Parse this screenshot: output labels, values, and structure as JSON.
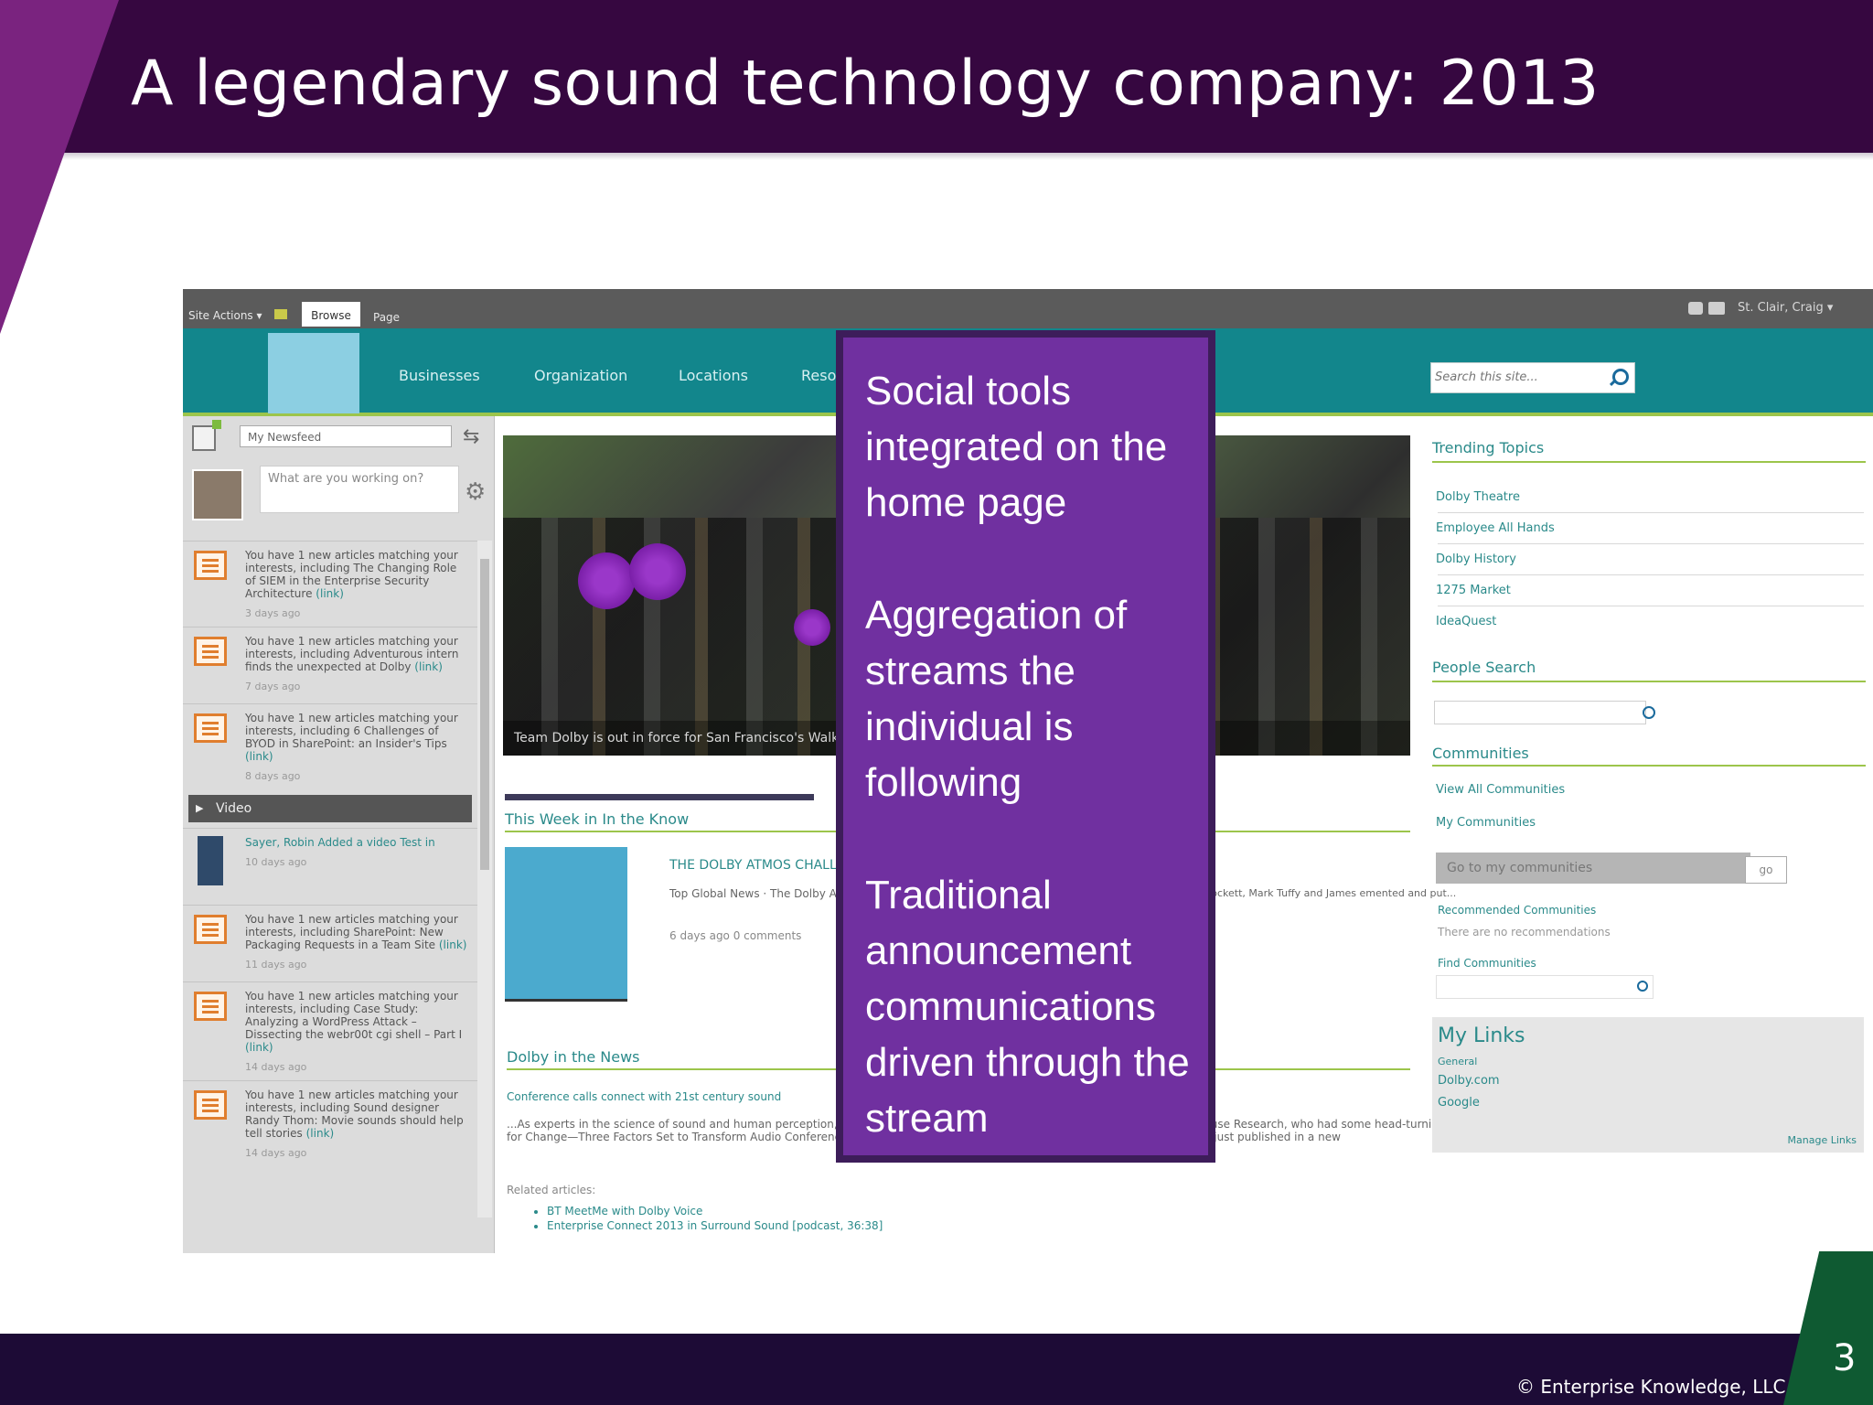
{
  "slide": {
    "title": "A legendary sound technology company: 2013",
    "page_number": "3",
    "copyright": "© Enterprise Knowledge, LLC"
  },
  "colors": {
    "title_bar": "#360740",
    "accent_purple": "#7a237f",
    "footer_bar": "#1d0b36",
    "callout": "#7030a0",
    "nav_teal": "#12868c",
    "link_teal": "#2a8a8a"
  },
  "ribbon": {
    "site_actions": "Site Actions ▾",
    "tab_browse": "Browse",
    "tab_page": "Page",
    "user": "St. Clair, Craig ▾"
  },
  "nav": {
    "items": [
      "Businesses",
      "Organization",
      "Locations",
      "Reso"
    ],
    "search_placeholder": "Search this site..."
  },
  "newsfeed": {
    "selector": "My Newsfeed",
    "status_placeholder": "What are you working on?",
    "items": [
      {
        "text": "You have 1 new articles matching your interests, including The Changing Role of SIEM in the Enterprise Security Architecture",
        "link": "(link)",
        "age": "3 days ago"
      },
      {
        "text": "You have 1 new articles matching your interests, including Adventurous intern finds the unexpected at Dolby",
        "link": "(link)",
        "age": "7 days ago"
      },
      {
        "text": "You have 1 new articles matching your interests, including 6 Challenges of BYOD in SharePoint: an Insider's Tips",
        "link": "(link)",
        "age": "8 days ago"
      }
    ],
    "video_label": "Video",
    "video_item": {
      "text": "Sayer, Robin Added a video Test in",
      "age": "10 days ago"
    },
    "items_after": [
      {
        "text": "You have 1 new articles matching your interests, including SharePoint: New Packaging Requests in a Team Site",
        "link": "(link)",
        "age": "11 days ago"
      },
      {
        "text": "You have 1 new articles matching your interests, including Case Study: Analyzing a WordPress Attack – Dissecting the webr00t cgi shell – Part I",
        "link": "(link)",
        "age": "14 days ago"
      },
      {
        "text": "You have 1 new articles matching your interests, including Sound designer Randy Thom: Movie sounds should help tell stories",
        "link": "(link)",
        "age": "14 days ago"
      }
    ]
  },
  "main": {
    "hero_caption": "Team Dolby is out in force for San Francisco's Walk",
    "in_the_know": {
      "heading": "This Week in In the Know",
      "title": "THE DOLBY ATMOS CHALL",
      "snippet": "Top Global News · The Dolby A Shannon, who together creat",
      "snippet_right": "rockett, Mark Tuffy and James emented and put...",
      "meta": "6 days ago   0 comments"
    },
    "in_the_news": {
      "heading": "Dolby in the News",
      "article_link": "Conference calls connect with 21st century sound",
      "body": "...As experts in the science of sound and human perception, making it sound more like an in-person meeting with Dolby Wainhouse Research, who had some head-turning insights. white paper called Rise for Change—Three Factors Set to Transform Audio Conferencing",
      "body_right": "r the workday conference call, d with market experts at ndings, just published in a new",
      "related_label": "Related articles:",
      "related": [
        "BT MeetMe with Dolby Voice",
        "Enterprise Connect 2013 in Surround Sound [podcast, 36:38]"
      ]
    }
  },
  "sidebar_right": {
    "trending_heading": "Trending Topics",
    "trending": [
      "Dolby Theatre",
      "Employee All Hands",
      "Dolby History",
      "1275 Market",
      "IdeaQuest"
    ],
    "people_heading": "People Search",
    "communities_heading": "Communities",
    "view_all": "View All Communities",
    "my_communities": "My Communities",
    "go_select": "Go to my communities",
    "go_button": "go",
    "recommended": "Recommended Communities",
    "no_rec": "There are no recommendations",
    "find": "Find Communities",
    "my_links": {
      "heading": "My Links",
      "group": "General",
      "links": [
        "Dolby.com",
        "Google"
      ],
      "manage": "Manage Links"
    }
  },
  "callout": {
    "paragraphs": [
      "Social tools integrated on the home page",
      "Aggregation of streams the individual is following",
      "Traditional announcement communications driven through the stream"
    ]
  }
}
